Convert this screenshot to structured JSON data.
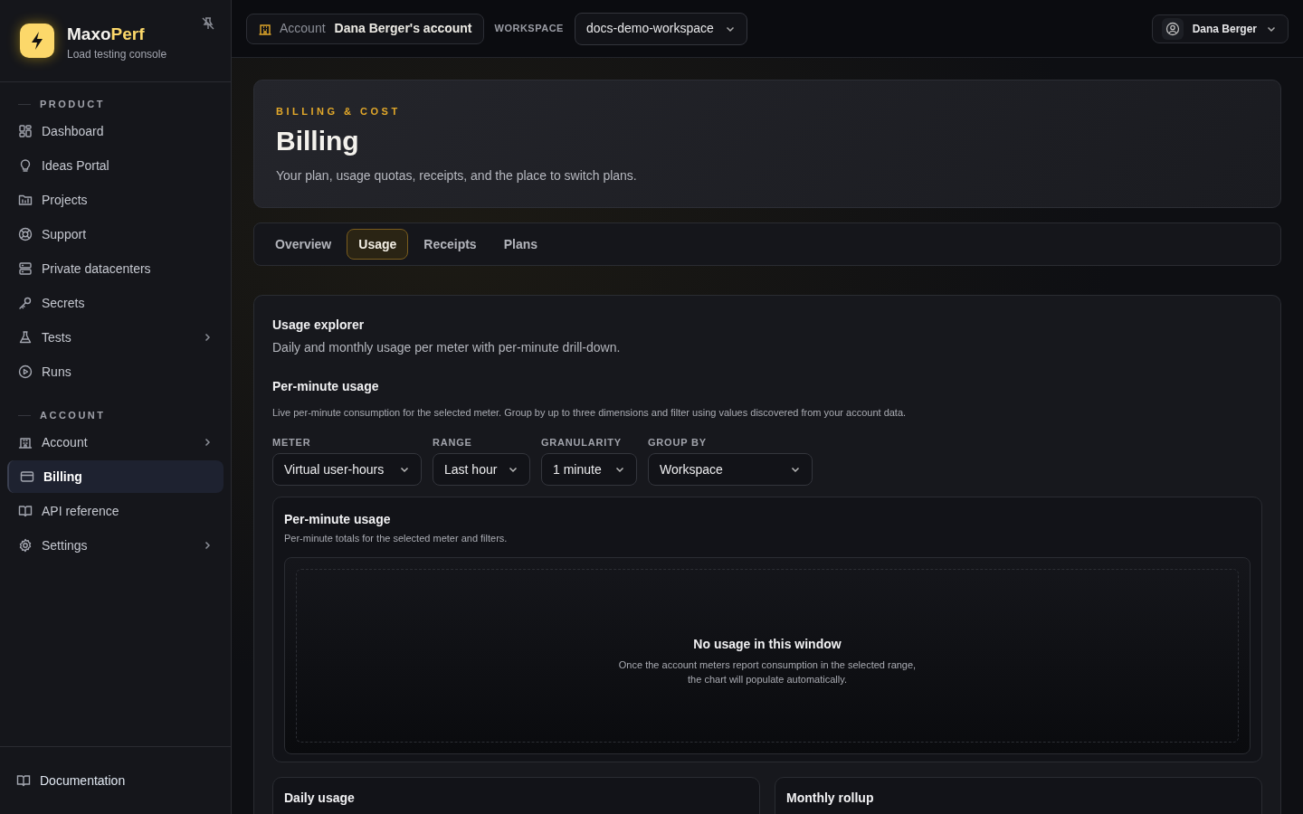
{
  "brand": {
    "name_main": "Maxo",
    "name_accent": "Perf",
    "subtitle": "Load testing console"
  },
  "sidebar": {
    "sections": [
      {
        "title": "PRODUCT",
        "items": [
          {
            "label": "Dashboard",
            "selected": false,
            "has_submenu": false
          },
          {
            "label": "Ideas Portal",
            "selected": false,
            "has_submenu": false
          },
          {
            "label": "Projects",
            "selected": false,
            "has_submenu": false
          },
          {
            "label": "Support",
            "selected": false,
            "has_submenu": false
          },
          {
            "label": "Private datacenters",
            "selected": false,
            "has_submenu": false
          },
          {
            "label": "Secrets",
            "selected": false,
            "has_submenu": false
          },
          {
            "label": "Tests",
            "selected": false,
            "has_submenu": true
          },
          {
            "label": "Runs",
            "selected": false,
            "has_submenu": false
          }
        ]
      },
      {
        "title": "ACCOUNT",
        "items": [
          {
            "label": "Account",
            "selected": false,
            "has_submenu": true
          },
          {
            "label": "Billing",
            "selected": true,
            "has_submenu": false
          },
          {
            "label": "API reference",
            "selected": false,
            "has_submenu": false
          },
          {
            "label": "Settings",
            "selected": false,
            "has_submenu": true
          }
        ]
      }
    ],
    "footer_link": "Documentation"
  },
  "topbar": {
    "account_label": "Account",
    "account_name": "Dana Berger's account",
    "workspace_label": "WORKSPACE",
    "workspace": "docs-demo-workspace",
    "user": "Dana Berger"
  },
  "header": {
    "eyebrow": "BILLING & COST",
    "title": "Billing",
    "description": "Your plan, usage quotas, receipts, and the place to switch plans."
  },
  "tabs": [
    {
      "label": "Overview",
      "selected": false
    },
    {
      "label": "Usage",
      "selected": true
    },
    {
      "label": "Receipts",
      "selected": false
    },
    {
      "label": "Plans",
      "selected": false
    }
  ],
  "usage_explorer": {
    "title": "Usage explorer",
    "subtitle": "Daily and monthly usage per meter with per-minute drill-down.",
    "section_title": "Per-minute usage",
    "section_description": "Live per-minute consumption for the selected meter. Group by up to three dimensions and filter using values discovered from your account data.",
    "filters": [
      {
        "label": "METER",
        "value": "Virtual user-hours"
      },
      {
        "label": "RANGE",
        "value": "Last hour"
      },
      {
        "label": "GRANULARITY",
        "value": "1 minute"
      },
      {
        "label": "GROUP BY",
        "value": "Workspace"
      }
    ],
    "chart_card": {
      "title": "Per-minute usage",
      "subtitle": "Per-minute totals for the selected meter and filters.",
      "empty_title": "No usage in this window",
      "empty_lines": [
        "Once the account meters report consumption in the selected range,",
        "the chart will populate automatically."
      ]
    },
    "bottom_cards": [
      {
        "title": "Daily usage"
      },
      {
        "title": "Monthly rollup"
      }
    ]
  }
}
